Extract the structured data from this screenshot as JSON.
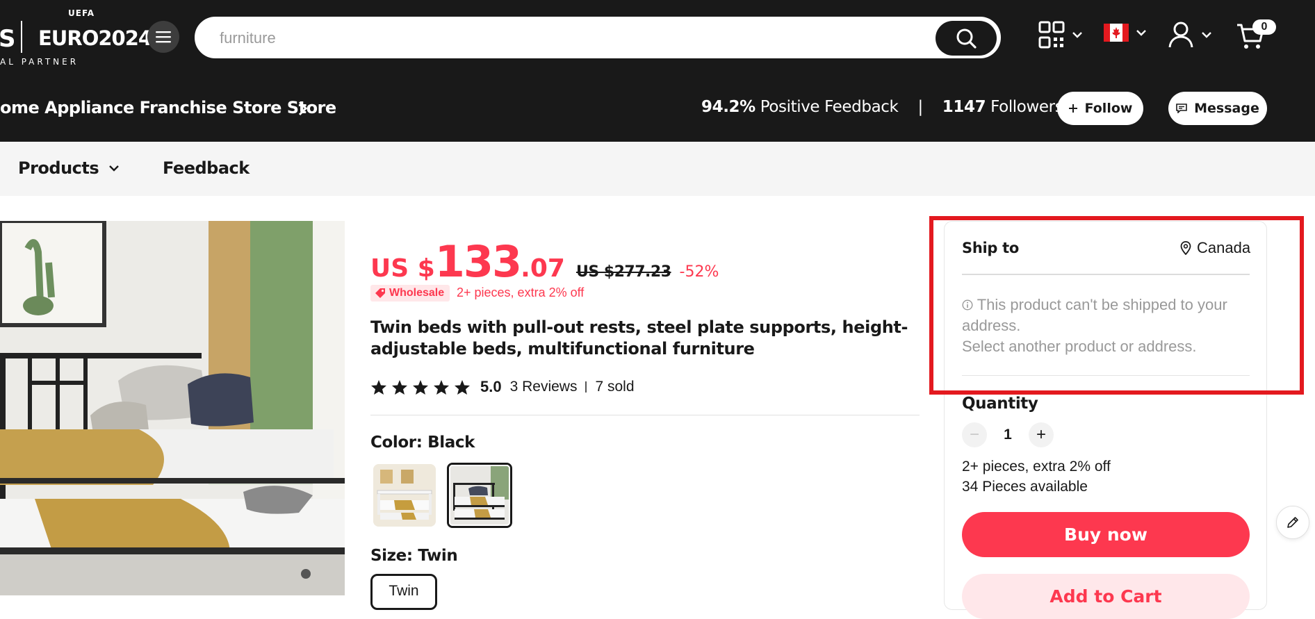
{
  "header": {
    "logo_letter": "S",
    "euro_uefa": "UEFA",
    "euro_title": "EURO2024",
    "euro_tm": "™",
    "euro_partner": "AL PARTNER",
    "search_placeholder": "furniture",
    "search_icon": "search-icon",
    "cart_count": "0"
  },
  "store": {
    "name": "ome Appliance Franchise Store Store",
    "feedback_pct": "94.2%",
    "feedback_label": "Positive Feedback",
    "separator": "|",
    "followers_count": "1147",
    "followers_label": "Followers",
    "follow_label": "Follow",
    "message_label": "Message"
  },
  "nav": {
    "products_label": "Products",
    "feedback_label": "Feedback"
  },
  "product": {
    "currency": "US $",
    "price_int": "133",
    "price_dec": ".07",
    "old_price": "US $277.23",
    "discount": "-52%",
    "wholesale_badge": "Wholesale",
    "wholesale_text": "2+ pieces, extra 2% off",
    "title": "Twin beds with pull-out rests, steel plate supports, height-adjustable beds, multifunctional furniture",
    "rating": 5,
    "rating_text": "5.0",
    "reviews": "3 Reviews",
    "sold": "7 sold",
    "color_label": "Color: Black",
    "color_options": [
      "White",
      "Black"
    ],
    "selected_color": "Black",
    "size_label": "Size: Twin",
    "size_option": "Twin"
  },
  "panel": {
    "ship_to_label": "Ship to",
    "ship_country": "Canada",
    "notice_line1": "This product can't be shipped to your address.",
    "notice_line2": "Select another product or address.",
    "quantity_label": "Quantity",
    "quantity_value": "1",
    "minus": "−",
    "plus": "+",
    "wholesale_info": "2+ pieces, extra 2% off",
    "available": "34 Pieces available",
    "buy_now": "Buy now",
    "add_to_cart": "Add to Cart"
  },
  "colors": {
    "accent": "#fd384f",
    "header_bg": "#191919",
    "highlight_border": "#e3191f"
  }
}
